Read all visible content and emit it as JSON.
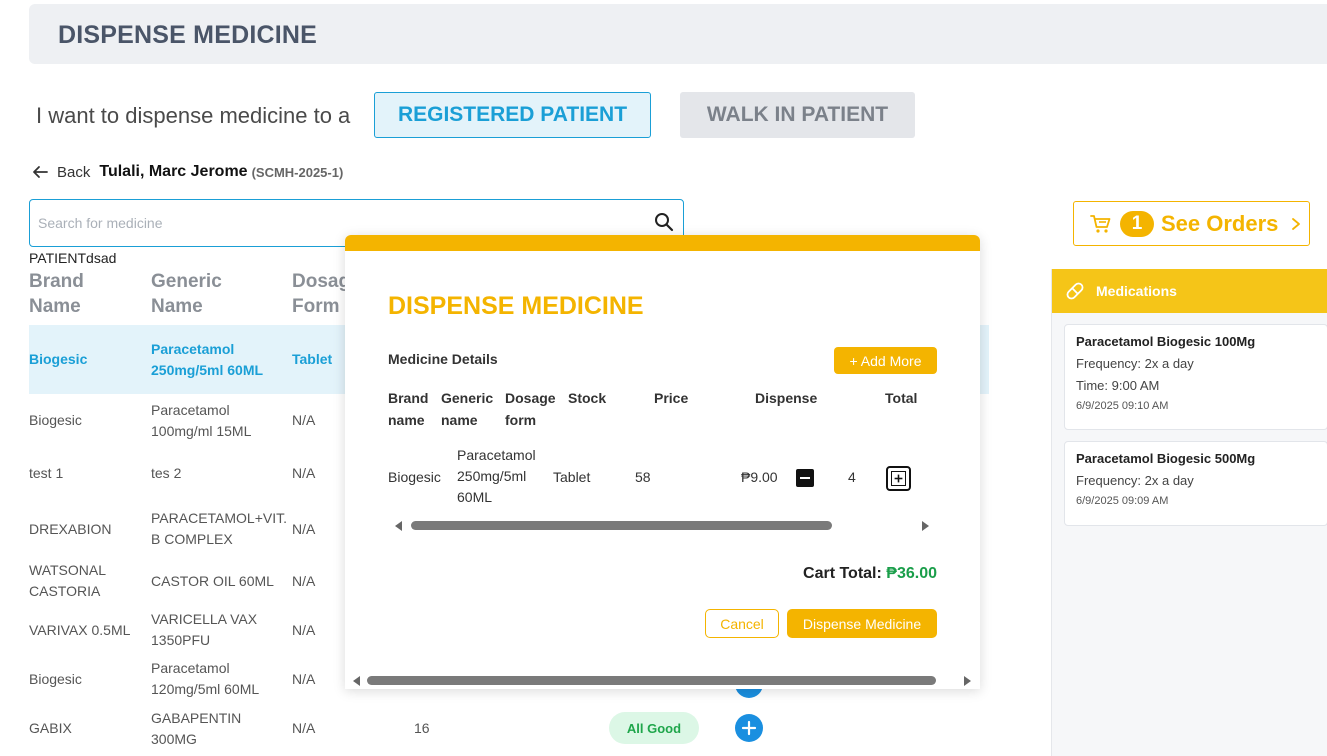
{
  "header": {
    "title": "DISPENSE MEDICINE"
  },
  "patient_type": {
    "prompt": "I want to dispense medicine to a",
    "registered_label": "REGISTERED PATIENT",
    "walkin_label": "WALK IN PATIENT",
    "selected": "registered"
  },
  "patient": {
    "back_label": "Back",
    "name": "Tulali, Marc Jerome",
    "id": "(SCMH-2025-1)"
  },
  "search": {
    "placeholder": "Search for medicine",
    "value": ""
  },
  "stray_text": "PATIENTdsad",
  "table": {
    "headers": {
      "brand": "Brand Name",
      "generic": "Generic Name",
      "dosage": "Dosage Form"
    },
    "rows": [
      {
        "brand": "Biogesic",
        "generic": "Paracetamol 250mg/5ml 60ML",
        "dosage": "Tablet",
        "stock": "",
        "status": "",
        "selected": true
      },
      {
        "brand": "Biogesic",
        "generic": "Paracetamol 100mg/ml 15ML",
        "dosage": "N/A",
        "stock": "",
        "status": ""
      },
      {
        "brand": "test 1",
        "generic": "tes 2",
        "dosage": "N/A",
        "stock": "",
        "status": ""
      },
      {
        "brand": "DREXABION",
        "generic": "PARACETAMOL+VIT. B COMPLEX",
        "dosage": "N/A",
        "stock": "",
        "status": ""
      },
      {
        "brand": "WATSONAL CASTORIA",
        "generic": "CASTOR OIL 60ML",
        "dosage": "N/A",
        "stock": "",
        "status": ""
      },
      {
        "brand": "VARIVAX 0.5ML",
        "generic": "VARICELLA VAX 1350PFU",
        "dosage": "N/A",
        "stock": "",
        "status": ""
      },
      {
        "brand": "Biogesic",
        "generic": "Paracetamol 120mg/5ml 60ML",
        "dosage": "N/A",
        "stock": "",
        "status": ""
      },
      {
        "brand": "GABIX",
        "generic": "GABAPENTIN 300MG",
        "dosage": "N/A",
        "stock": "16",
        "status": "All Good"
      }
    ]
  },
  "orders": {
    "count": "1",
    "label": "See Orders"
  },
  "medications": {
    "title": "Medications",
    "items": [
      {
        "name": "Paracetamol Biogesic 100Mg",
        "frequency": "Frequency:  2x a day",
        "time": "Time:  9:00 AM",
        "date": "6/9/2025 09:10 AM"
      },
      {
        "name": "Paracetamol Biogesic 500Mg",
        "frequency": "Frequency:  2x a day",
        "date": "6/9/2025 09:09 AM"
      }
    ]
  },
  "modal": {
    "title": "DISPENSE MEDICINE",
    "details_label": "Medicine Details",
    "add_more_label": "+ Add More",
    "headers": {
      "brand": "Brand name",
      "generic": "Generic name",
      "dosage": "Dosage form",
      "stock": "Stock",
      "price": "Price",
      "dispense": "Dispense",
      "total": "Total"
    },
    "item": {
      "brand": "Biogesic",
      "generic": "Paracetamol 250mg/5ml 60ML",
      "dosage": "Tablet",
      "stock": "58",
      "price": "₱9.00",
      "quantity": "4",
      "total": ""
    },
    "cart_total_label": "Cart Total:",
    "cart_total_value": "₱36.00",
    "cancel_label": "Cancel",
    "dispense_label": "Dispense Medicine"
  },
  "colors": {
    "accent": "#f4b400",
    "primary": "#1a9fd6",
    "success": "#1fa64b",
    "panel_header": "#f5c518"
  },
  "icons": [
    "back-arrow-icon",
    "search-icon",
    "cart-icon",
    "chevron-right-icon",
    "pill-icon",
    "minus-icon",
    "plus-icon",
    "add-circle-icon"
  ]
}
